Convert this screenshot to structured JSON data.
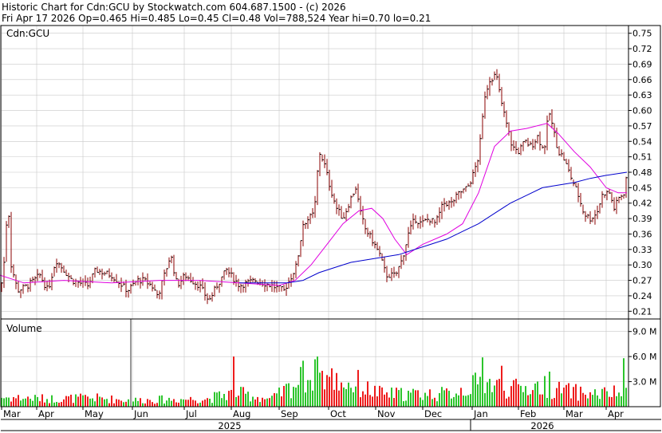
{
  "header": {
    "line1": "Historic Chart for Cdn:GCU by Stockwatch.com 604.687.1500 - (c) 2026",
    "line2": "Fri Apr 17 2026  Op=0.465  Hi=0.485  Lo=0.45  Cl=0.48  Vol=788,524  Year hi=0.70  lo=0.21"
  },
  "chart_data": {
    "type": "ohlc-bar",
    "symbol_label": "Cdn:GCU",
    "volume_label": "Volume",
    "price_axis": {
      "ylim": [
        0.195,
        0.765
      ],
      "ticks": [
        "0.75",
        "0.72",
        "0.69",
        "0.66",
        "0.63",
        "0.60",
        "0.57",
        "0.54",
        "0.51",
        "0.48",
        "0.45",
        "0.42",
        "0.39",
        "0.36",
        "0.33",
        "0.30",
        "0.27",
        "0.24",
        "0.21"
      ]
    },
    "volume_axis": {
      "ylim": [
        0,
        10.5
      ],
      "ticks": [
        "9.0 M",
        "6.0 M",
        "3.0 M"
      ],
      "tick_values": [
        9,
        6,
        3
      ]
    },
    "months": [
      "Mar",
      "Apr",
      "May",
      "Jun",
      "Jul",
      "Aug",
      "Sep",
      "Oct",
      "Nov",
      "Dec",
      "Jan",
      "Feb",
      "Mar",
      "Apr"
    ],
    "years": [
      "2025",
      "2026"
    ],
    "grid": true,
    "price_anchors": [
      [
        0,
        0.25
      ],
      [
        4,
        0.28
      ],
      [
        10,
        0.43
      ],
      [
        14,
        0.3
      ],
      [
        22,
        0.25
      ],
      [
        35,
        0.26
      ],
      [
        50,
        0.28
      ],
      [
        60,
        0.25
      ],
      [
        70,
        0.31
      ],
      [
        90,
        0.27
      ],
      [
        110,
        0.26
      ],
      [
        120,
        0.29
      ],
      [
        140,
        0.28
      ],
      [
        160,
        0.25
      ],
      [
        172,
        0.27
      ],
      [
        180,
        0.27
      ],
      [
        190,
        0.26
      ],
      [
        198,
        0.24
      ],
      [
        206,
        0.28
      ],
      [
        214,
        0.32
      ],
      [
        222,
        0.26
      ],
      [
        232,
        0.28
      ],
      [
        240,
        0.27
      ],
      [
        250,
        0.26
      ],
      [
        262,
        0.23
      ],
      [
        272,
        0.26
      ],
      [
        284,
        0.29
      ],
      [
        300,
        0.26
      ],
      [
        320,
        0.27
      ],
      [
        340,
        0.26
      ],
      [
        356,
        0.25
      ],
      [
        366,
        0.28
      ],
      [
        372,
        0.3
      ],
      [
        380,
        0.38
      ],
      [
        394,
        0.4
      ],
      [
        400,
        0.52
      ],
      [
        406,
        0.5
      ],
      [
        414,
        0.45
      ],
      [
        422,
        0.41
      ],
      [
        430,
        0.39
      ],
      [
        440,
        0.43
      ],
      [
        446,
        0.45
      ],
      [
        452,
        0.4
      ],
      [
        458,
        0.37
      ],
      [
        466,
        0.35
      ],
      [
        476,
        0.32
      ],
      [
        484,
        0.28
      ],
      [
        496,
        0.28
      ],
      [
        504,
        0.31
      ],
      [
        512,
        0.36
      ],
      [
        520,
        0.39
      ],
      [
        528,
        0.38
      ],
      [
        538,
        0.39
      ],
      [
        546,
        0.38
      ],
      [
        556,
        0.42
      ],
      [
        566,
        0.42
      ],
      [
        576,
        0.44
      ],
      [
        586,
        0.45
      ],
      [
        592,
        0.47
      ],
      [
        600,
        0.51
      ],
      [
        608,
        0.63
      ],
      [
        614,
        0.66
      ],
      [
        622,
        0.67
      ],
      [
        628,
        0.62
      ],
      [
        634,
        0.58
      ],
      [
        642,
        0.53
      ],
      [
        650,
        0.52
      ],
      [
        658,
        0.54
      ],
      [
        666,
        0.53
      ],
      [
        674,
        0.55
      ],
      [
        682,
        0.52
      ],
      [
        688,
        0.6
      ],
      [
        694,
        0.56
      ],
      [
        700,
        0.52
      ],
      [
        706,
        0.51
      ],
      [
        716,
        0.47
      ],
      [
        724,
        0.44
      ],
      [
        732,
        0.4
      ],
      [
        740,
        0.39
      ],
      [
        748,
        0.4
      ],
      [
        756,
        0.44
      ],
      [
        764,
        0.44
      ],
      [
        770,
        0.41
      ],
      [
        776,
        0.43
      ],
      [
        782,
        0.44
      ],
      [
        786,
        0.48
      ]
    ],
    "ma_short": [
      [
        0,
        0.28
      ],
      [
        30,
        0.265
      ],
      [
        80,
        0.27
      ],
      [
        140,
        0.265
      ],
      [
        200,
        0.27
      ],
      [
        250,
        0.27
      ],
      [
        300,
        0.265
      ],
      [
        350,
        0.26
      ],
      [
        370,
        0.27
      ],
      [
        390,
        0.3
      ],
      [
        410,
        0.34
      ],
      [
        430,
        0.38
      ],
      [
        450,
        0.405
      ],
      [
        466,
        0.41
      ],
      [
        480,
        0.39
      ],
      [
        495,
        0.35
      ],
      [
        510,
        0.32
      ],
      [
        530,
        0.34
      ],
      [
        560,
        0.36
      ],
      [
        580,
        0.38
      ],
      [
        600,
        0.44
      ],
      [
        620,
        0.53
      ],
      [
        640,
        0.56
      ],
      [
        660,
        0.565
      ],
      [
        686,
        0.575
      ],
      [
        700,
        0.555
      ],
      [
        720,
        0.52
      ],
      [
        740,
        0.49
      ],
      [
        760,
        0.45
      ],
      [
        775,
        0.44
      ],
      [
        786,
        0.44
      ]
    ],
    "ma_long": [
      [
        300,
        0.265
      ],
      [
        340,
        0.265
      ],
      [
        360,
        0.265
      ],
      [
        380,
        0.27
      ],
      [
        400,
        0.285
      ],
      [
        420,
        0.295
      ],
      [
        440,
        0.305
      ],
      [
        460,
        0.31
      ],
      [
        480,
        0.315
      ],
      [
        500,
        0.32
      ],
      [
        520,
        0.33
      ],
      [
        540,
        0.34
      ],
      [
        560,
        0.35
      ],
      [
        580,
        0.365
      ],
      [
        600,
        0.38
      ],
      [
        620,
        0.4
      ],
      [
        640,
        0.42
      ],
      [
        660,
        0.435
      ],
      [
        680,
        0.45
      ],
      [
        700,
        0.455
      ],
      [
        720,
        0.46
      ],
      [
        740,
        0.468
      ],
      [
        760,
        0.474
      ],
      [
        786,
        0.48
      ]
    ],
    "volume_anchors": [
      [
        0,
        1.2
      ],
      [
        60,
        1.0
      ],
      [
        120,
        1.1
      ],
      [
        163,
        0.8
      ],
      [
        200,
        0.9
      ],
      [
        260,
        1.0
      ],
      [
        294,
        1.8
      ],
      [
        340,
        0.9
      ],
      [
        380,
        3.5
      ],
      [
        400,
        4.0
      ],
      [
        440,
        2.8
      ],
      [
        480,
        1.6
      ],
      [
        520,
        1.6
      ],
      [
        560,
        1.6
      ],
      [
        590,
        2.5
      ],
      [
        605,
        3.2
      ],
      [
        640,
        2.2
      ],
      [
        680,
        2.6
      ],
      [
        700,
        2.1
      ],
      [
        740,
        1.6
      ],
      [
        770,
        1.7
      ],
      [
        786,
        1.8
      ]
    ],
    "volume_spikes": [
      [
        163,
        10.5
      ],
      [
        294,
        6.0
      ],
      [
        380,
        5.5
      ],
      [
        398,
        6.0
      ],
      [
        450,
        4.4
      ],
      [
        604,
        5.9
      ],
      [
        630,
        4.9
      ],
      [
        688,
        4.2
      ],
      [
        783,
        5.8
      ]
    ]
  },
  "colors": {
    "bar": "#8b0000",
    "tick": "#000000",
    "ma_short": "#e000e0",
    "ma_long": "#0000cc",
    "vol_up": "#2cc52c",
    "vol_down": "#ee1c1c",
    "vol_special": "#999999",
    "grid": "#c8c8c8"
  }
}
